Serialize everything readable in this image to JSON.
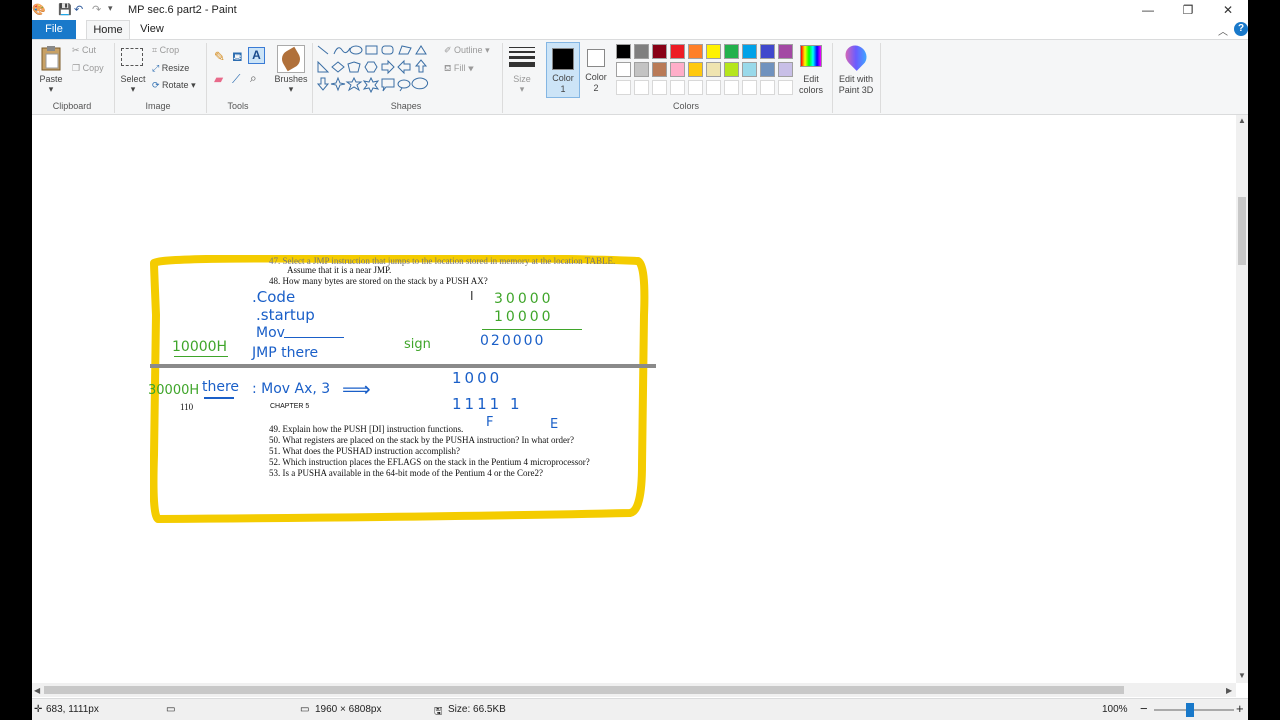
{
  "window": {
    "title": "MP sec.6 part2 - Paint"
  },
  "tabs": {
    "file": "File",
    "home": "Home",
    "view": "View"
  },
  "ribbon": {
    "clipboard": {
      "label": "Clipboard",
      "paste": "Paste",
      "cut": "Cut",
      "copy": "Copy"
    },
    "image": {
      "label": "Image",
      "select": "Select",
      "crop": "Crop",
      "resize": "Resize",
      "rotate": "Rotate"
    },
    "tools": {
      "label": "Tools",
      "brushes": "Brushes"
    },
    "shapes": {
      "label": "Shapes",
      "outline": "Outline",
      "fill": "Fill"
    },
    "size": "Size",
    "color1": {
      "line1": "Color",
      "line2": "1"
    },
    "color2": {
      "line1": "Color",
      "line2": "2"
    },
    "colors": {
      "label": "Colors",
      "edit_line1": "Edit",
      "edit_line2": "colors",
      "paint3d_line1": "Edit with",
      "paint3d_line2": "Paint 3D"
    },
    "palette": [
      "#000000",
      "#7f7f7f",
      "#880015",
      "#ed1c24",
      "#ff7f27",
      "#fff200",
      "#22b14c",
      "#00a2e8",
      "#3f48cc",
      "#a349a4",
      "#ffffff",
      "#c3c3c3",
      "#b97a57",
      "#ffaec9",
      "#ffc90e",
      "#efe4b0",
      "#b5e61d",
      "#99d9ea",
      "#7092be",
      "#c8bfe7"
    ]
  },
  "document": {
    "q47_cut": "47.   Select a JMP instruction that jumps to the location stored in memory at the location TABLE.",
    "q47_b": "Assume that it is a near JMP.",
    "q48": "48.   How many bytes are stored on the stack by a PUSH AX?",
    "page_number": "110",
    "chapter": "CHAPTER 5",
    "q49": "49.   Explain how the PUSH [DI] instruction functions.",
    "q50": "50.   What registers are placed on the stack by the PUSHA instruction? In what order?",
    "q51": "51.   What does the PUSHAD instruction accomplish?",
    "q52": "52.   Which instruction places the EFLAGS on the stack in the Pentium 4 microprocessor?",
    "q53": "53.   Is a PUSHA available in the 64-bit mode of the Pentium 4 or the Core2?"
  },
  "handwriting": {
    "code": ".Code",
    "startup": ".startup",
    "mov": "Mov",
    "jmp": "JMP there",
    "addr1": "10000H",
    "addr2": "30000H",
    "there": "there",
    "mov_ax": ": Mov Ax, 3",
    "arrow": "⟹",
    "sign": "sign",
    "n1": "30000",
    "n2": "10000",
    "n3": "020000",
    "b1": "1000",
    "b2": "1111  1",
    "f": "F",
    "e": "E"
  },
  "status": {
    "cursor": "683, 1111px",
    "dimensions": "1960 × 6808px",
    "size": "Size: 66.5KB",
    "zoom": "100%"
  }
}
